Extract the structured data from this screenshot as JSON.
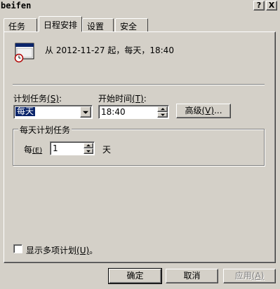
{
  "window": {
    "title": "beifen",
    "help_glyph": "?",
    "close_glyph": "X"
  },
  "tabs": [
    {
      "label": "任务",
      "active": false
    },
    {
      "label": "日程安排",
      "active": true
    },
    {
      "label": "设置",
      "active": false
    },
    {
      "label": "安全",
      "active": false
    }
  ],
  "schedule": {
    "summary": "从 2012-11-27 起，每天，18:40",
    "icon": "calendar-clock-icon",
    "task_label": "计划任务",
    "task_mnemonic": "(S)",
    "task_label_suffix": ":",
    "task_value": "每天",
    "start_label": "开始时间",
    "start_mnemonic": "(T)",
    "start_label_suffix": ":",
    "start_value": "18:40",
    "advanced_label": "高级",
    "advanced_mnemonic": "(V)",
    "advanced_suffix": "..."
  },
  "daily": {
    "group_title": "每天计划任务",
    "every_label": "每",
    "every_mnemonic": "(E)",
    "every_value": "1",
    "unit": "天"
  },
  "multi": {
    "label": "显示多项计划",
    "mnemonic": "(U)",
    "suffix": "。",
    "checked": false
  },
  "footer": {
    "ok_label": "确定",
    "cancel_label": "取消",
    "apply_label": "应用",
    "apply_mnemonic": "(A)"
  },
  "colors": {
    "face": "#d4d0c8",
    "selection": "#0a246a"
  }
}
